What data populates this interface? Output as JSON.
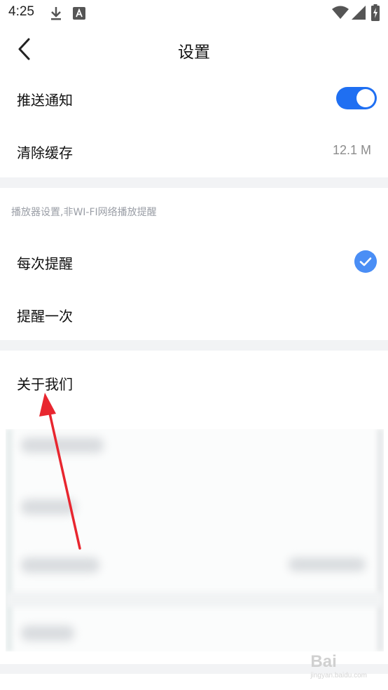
{
  "status_bar": {
    "time": "4:25"
  },
  "header": {
    "title": "设置"
  },
  "settings": {
    "push_notification": {
      "label": "推送通知",
      "enabled": true
    },
    "clear_cache": {
      "label": "清除缓存",
      "value": "12.1 M"
    }
  },
  "player_section": {
    "hint": "播放器设置,非WI-FI网络播放提醒",
    "options": [
      {
        "label": "每次提醒",
        "selected": true
      },
      {
        "label": "提醒一次",
        "selected": false
      }
    ]
  },
  "about": {
    "label": "关于我们"
  },
  "colors": {
    "accent": "#1f6ff2",
    "check": "#4a8ef5",
    "annotation_arrow": "#e8262f",
    "gap": "#f2f3f5"
  },
  "watermark": {
    "brand": "Bai",
    "sub": "jingyan.baidu.com"
  }
}
